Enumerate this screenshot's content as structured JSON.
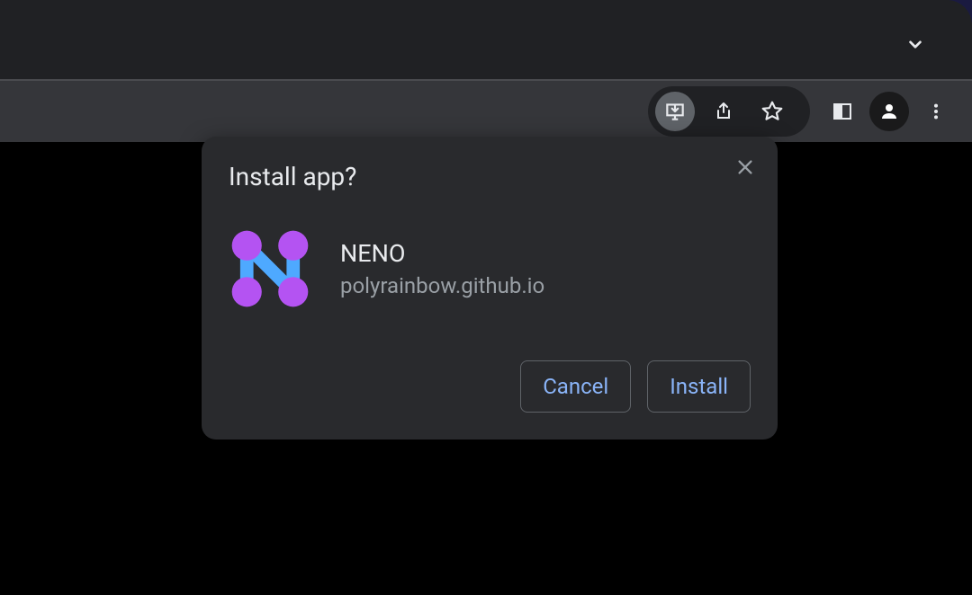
{
  "dialog": {
    "title": "Install app?",
    "app_name": "NENO",
    "app_origin": "polyrainbow.github.io",
    "cancel_label": "Cancel",
    "install_label": "Install"
  },
  "toolbar": {
    "icons": {
      "install": "install-desktop-icon",
      "share": "share-icon",
      "bookmark": "star-outline-icon",
      "side_panel": "side-panel-icon",
      "profile": "person-icon",
      "menu": "kebab-menu-icon",
      "tabs_dropdown": "chevron-down-icon"
    }
  },
  "colors": {
    "accent": "#8ab4f8",
    "dialog_bg": "#292a2d",
    "toolbar_bg": "#35363a",
    "tab_strip_bg": "#202124",
    "app_icon_purple": "#b453f2",
    "app_icon_blue": "#4ea9ff"
  }
}
